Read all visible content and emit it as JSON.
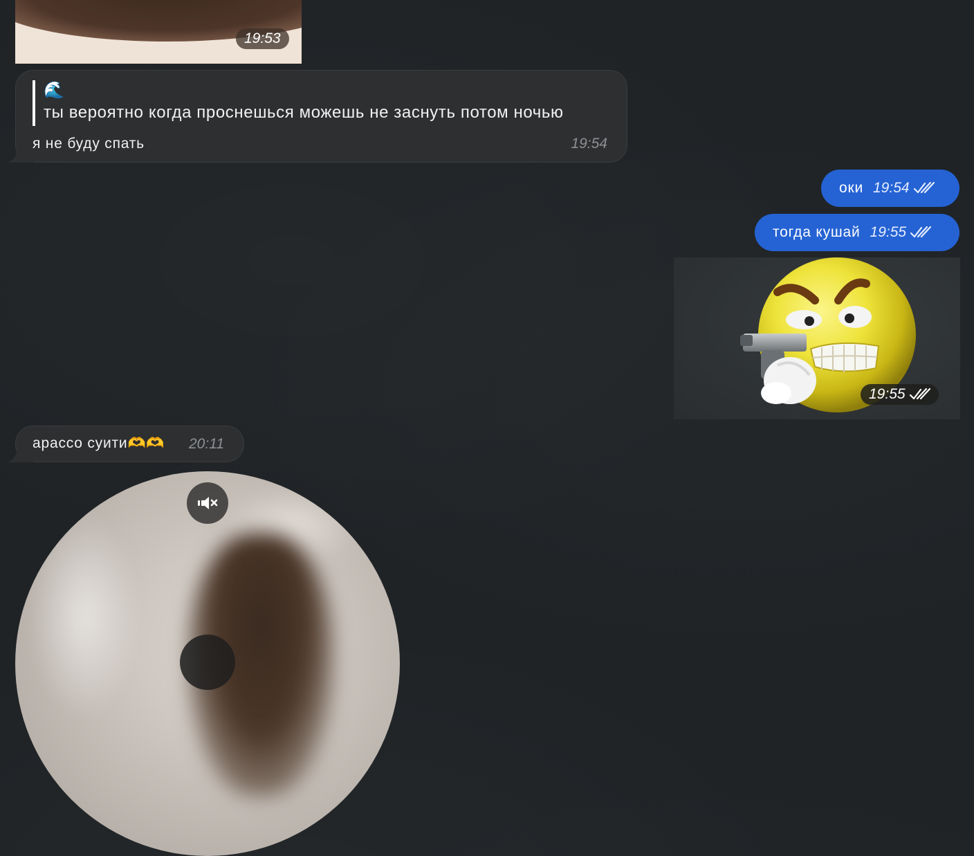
{
  "messages": {
    "photo_top": {
      "time": "19:53"
    },
    "reply_message": {
      "quote_emoji": "🌊",
      "quote_text": "ты вероятно когда проснешься можешь не заснуть потом ночью",
      "text": "я не буду спать",
      "time": "19:54"
    },
    "out_1": {
      "text": "оки",
      "time": "19:54",
      "status_icon": "double-check-icon"
    },
    "out_2": {
      "text": "тогда кушай",
      "time": "19:55",
      "status_icon": "double-check-icon"
    },
    "sticker_gif": {
      "time": "19:55",
      "status_icon": "double-check-icon"
    },
    "in_2": {
      "text": "арассо суити🫶🫶",
      "time": "20:11"
    },
    "round_video": {
      "mute_icon": "speaker-muted-icon",
      "play_icon": "play-icon"
    }
  },
  "colors": {
    "background": "#1f2326",
    "incoming_bubble": "#2d2f31",
    "outgoing_bubble": "#2563d4"
  }
}
